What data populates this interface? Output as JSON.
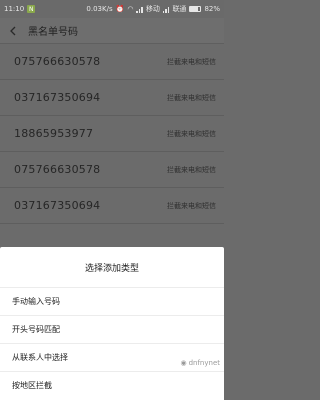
{
  "status_bar": {
    "time": "11:10",
    "notification": "N",
    "speed": "0.03K/s",
    "carrier1": "移动",
    "carrier2": "联通",
    "battery": "82%"
  },
  "header": {
    "title": "黑名单号码"
  },
  "list": {
    "rows": [
      {
        "number": "075766630578",
        "tag": "拦截来电和短信"
      },
      {
        "number": "037167350694",
        "tag": "拦截来电和短信"
      },
      {
        "number": "18865953977",
        "tag": "拦截来电和短信"
      },
      {
        "number": "075766630578",
        "tag": "拦截来电和短信"
      },
      {
        "number": "037167350694",
        "tag": "拦截来电和短信"
      }
    ]
  },
  "sheet": {
    "title": "选择添加类型",
    "options": [
      "手动输入号码",
      "开头号码匹配",
      "从联系人中选择",
      "按地区拦截"
    ]
  },
  "watermark": {
    "text": "dnfnynet"
  }
}
